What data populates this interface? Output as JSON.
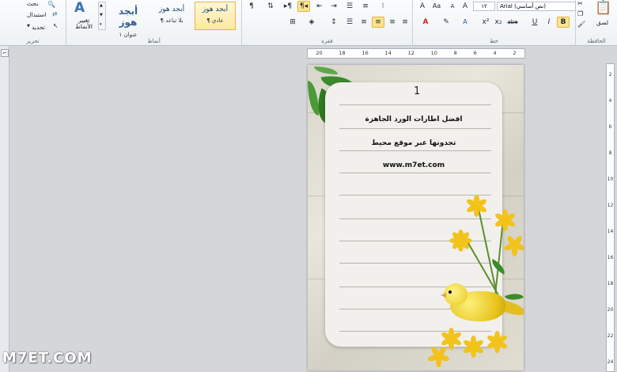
{
  "ribbon": {
    "editing": {
      "label": "تحرير",
      "find": "بحث",
      "replace": "استبدال",
      "select": "تحديد"
    },
    "styles": {
      "label": "أنماط",
      "change_styles": "تغيير الأنماط",
      "change_styles_icon": "A",
      "items": [
        {
          "sample": "أبجد هوز",
          "name": "عنوان ١"
        },
        {
          "sample": "أبجد هوز",
          "name": "¶ بلا تباعد"
        },
        {
          "sample": "أبجد هوز",
          "name": "¶ عادي"
        }
      ]
    },
    "paragraph": {
      "label": "فقرة",
      "pilcrow": "¶",
      "rtl": "¶◂",
      "ltr": "▸¶"
    },
    "font": {
      "label": "خط",
      "font_name": "Arial (نص أساسي)",
      "font_size": "١٢",
      "bold": "B",
      "italic": "I",
      "underline": "U",
      "strike": "abe",
      "subscript": "x₂",
      "superscript": "x²",
      "font_color_letter": "A",
      "grow": "A",
      "shrink": "A",
      "case": "Aa",
      "clear": "A"
    },
    "clipboard": {
      "label": "الحافظة",
      "paste": "لصق"
    }
  },
  "rulers": {
    "horizontal": [
      "20",
      "18",
      "16",
      "14",
      "12",
      "10",
      "8",
      "6",
      "4",
      "2"
    ],
    "vertical": [
      "2",
      "4",
      "6",
      "8",
      "10",
      "12",
      "14",
      "16",
      "18",
      "20",
      "22",
      "24"
    ]
  },
  "document": {
    "page_number": "1",
    "line1": "افضل اطارات الورد الجاهزة",
    "line2": "تجدونها عبر موقع محيط",
    "line3": "www.m7et.com"
  },
  "watermark": "M7ET.COM",
  "colors": {
    "accent_yellow": "#fde48d",
    "font_color_red": "#d32020",
    "highlight_yellow": "#fff200"
  }
}
